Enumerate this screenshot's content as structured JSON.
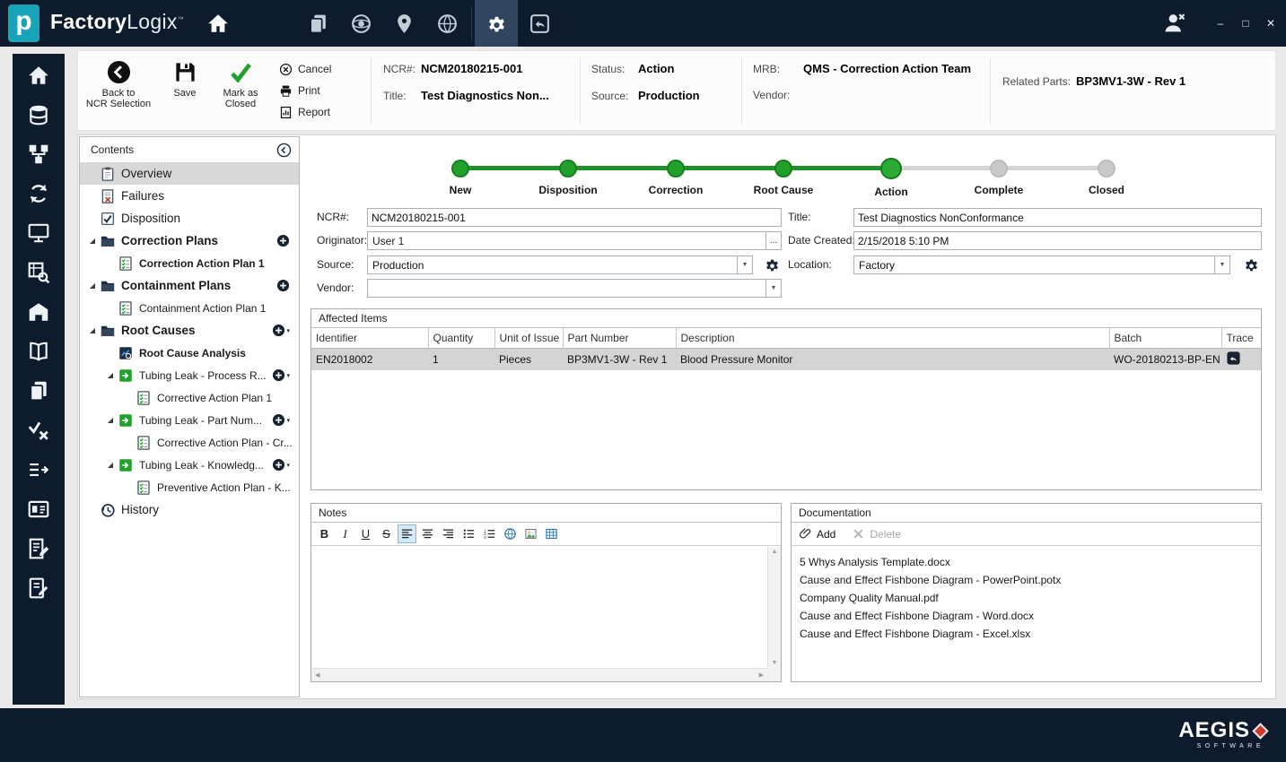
{
  "colors": {
    "navy": "#0e1b2c",
    "teal": "#18a3b8",
    "green": "#22a02c",
    "pending": "#c9c9c9",
    "selection": "#d8d8d8"
  },
  "titlebar": {
    "logo_letter": "p",
    "brand_bold": "Factory",
    "brand_light": "Logix",
    "trademark": "™",
    "nav_icons": [
      {
        "name": "copy-pages",
        "active": false
      },
      {
        "name": "network-sphere",
        "active": false
      },
      {
        "name": "location-pin",
        "active": false
      },
      {
        "name": "globe",
        "active": false
      },
      {
        "name": "gear",
        "active": true
      },
      {
        "name": "history-undo",
        "active": false
      }
    ],
    "window": {
      "minimize": "–",
      "maximize": "□",
      "close": "✕"
    }
  },
  "toolbar": {
    "back_line1": "Back to",
    "back_line2": "NCR Selection",
    "save_label": "Save",
    "mark_line1": "Mark as",
    "mark_line2": "Closed",
    "cancel_label": "Cancel",
    "print_label": "Print",
    "report_label": "Report",
    "groups": [
      {
        "rows": [
          {
            "label": "NCR#:",
            "value": "NCM20180215-001"
          },
          {
            "label": "Title:",
            "value": "Test Diagnostics Non..."
          }
        ]
      },
      {
        "rows": [
          {
            "label": "Status:",
            "value": "Action"
          },
          {
            "label": "Source:",
            "value": "Production"
          }
        ]
      },
      {
        "rows": [
          {
            "label": "MRB:",
            "value": "QMS - Correction Action Team"
          },
          {
            "label": "Vendor:",
            "value": ""
          }
        ]
      },
      {
        "rows": [
          {
            "label": "Related Parts:",
            "value": "BP3MV1-3W  - Rev 1"
          }
        ]
      }
    ]
  },
  "sidebar": {
    "icons": [
      "home",
      "materials",
      "assembly",
      "sync",
      "monitor",
      "inspection",
      "warehouse",
      "library",
      "documents",
      "quality",
      "transfer",
      "badge",
      "report-edit",
      "note-edit"
    ]
  },
  "contents": {
    "title": "Contents",
    "items": [
      {
        "label": "Overview",
        "icon": "clipboard",
        "level": 0,
        "selected": true,
        "size": "lg"
      },
      {
        "label": "Failures",
        "icon": "doc-x",
        "level": 0,
        "size": "lg"
      },
      {
        "label": "Disposition",
        "icon": "checkbox",
        "level": 0,
        "size": "lg"
      },
      {
        "label": "Correction Plans",
        "icon": "folder",
        "level": 0,
        "bold": true,
        "expander": true,
        "add": "plus",
        "size": "lg"
      },
      {
        "label": "Correction Action Plan 1",
        "icon": "plan",
        "level": 1,
        "bold": true
      },
      {
        "label": "Containment Plans",
        "icon": "folder",
        "level": 0,
        "bold": true,
        "expander": true,
        "add": "plus",
        "size": "lg"
      },
      {
        "label": "Containment Action Plan 1",
        "icon": "plan",
        "level": 1
      },
      {
        "label": "Root Causes",
        "icon": "folder",
        "level": 0,
        "bold": true,
        "expander": true,
        "add": "plus-menu",
        "size": "lg"
      },
      {
        "label": "Root Cause Analysis",
        "icon": "analysis",
        "level": 1,
        "bold": true
      },
      {
        "label": "Tubing Leak - Process R...",
        "icon": "cause",
        "level": 1,
        "expander": true,
        "add": "plus-menu"
      },
      {
        "label": "Corrective Action Plan 1",
        "icon": "plan",
        "level": 2
      },
      {
        "label": "Tubing Leak - Part Num...",
        "icon": "cause",
        "level": 1,
        "expander": true,
        "add": "plus-menu"
      },
      {
        "label": "Corrective Action Plan - Cr...",
        "icon": "plan",
        "level": 2
      },
      {
        "label": "Tubing Leak - Knowledg...",
        "icon": "cause",
        "level": 1,
        "expander": true,
        "add": "plus-menu"
      },
      {
        "label": "Preventive Action Plan - K...",
        "icon": "plan",
        "level": 2
      },
      {
        "label": "History",
        "icon": "history-clock",
        "level": 0,
        "size": "lg"
      }
    ]
  },
  "stepper": {
    "steps": [
      {
        "label": "New",
        "state": "done"
      },
      {
        "label": "Disposition",
        "state": "done"
      },
      {
        "label": "Correction",
        "state": "done"
      },
      {
        "label": "Root Cause",
        "state": "done"
      },
      {
        "label": "Action",
        "state": "current"
      },
      {
        "label": "Complete",
        "state": "pending"
      },
      {
        "label": "Closed",
        "state": "pending"
      }
    ]
  },
  "form": {
    "ncr": {
      "label": "NCR#:",
      "value": "NCM20180215-001"
    },
    "title": {
      "label": "Title:",
      "value": "Test Diagnostics NonConformance"
    },
    "originator": {
      "label": "Originator:",
      "value": "User 1",
      "browse": "..."
    },
    "date_created": {
      "label": "Date Created:",
      "value": "2/15/2018 5:10 PM"
    },
    "source": {
      "label": "Source:",
      "value": "Production"
    },
    "location": {
      "label": "Location:",
      "value": "Factory"
    },
    "vendor": {
      "label": "Vendor:",
      "value": ""
    }
  },
  "affected_items": {
    "title": "Affected Items",
    "columns": [
      "Identifier",
      "Quantity",
      "Unit of Issue",
      "Part Number",
      "Description",
      "Batch",
      "Trace"
    ],
    "rows": [
      {
        "identifier": "EN2018002",
        "quantity": "1",
        "unit": "Pieces",
        "part_number": "BP3MV1-3W - Rev 1",
        "description": "Blood Pressure Monitor",
        "batch": "WO-20180213-BP-EN",
        "trace_icon": "trace"
      }
    ]
  },
  "notes": {
    "title": "Notes",
    "toolbar": [
      "bold",
      "italic",
      "underline",
      "strikethrough",
      "align-left",
      "align-center",
      "align-right",
      "list-bullet",
      "list-ordered",
      "link",
      "image",
      "table"
    ],
    "active_tool": "align-left",
    "content": ""
  },
  "documentation": {
    "title": "Documentation",
    "add_label": "Add",
    "delete_label": "Delete",
    "files": [
      "5 Whys Analysis Template.docx",
      "Cause and Effect Fishbone Diagram - PowerPoint.potx",
      "Company Quality Manual.pdf",
      "Cause and Effect Fishbone Diagram - Word.docx",
      "Cause and Effect Fishbone Diagram - Excel.xlsx"
    ]
  },
  "footer": {
    "brand": "AEGIS",
    "tagline": "SOFTWARE"
  }
}
